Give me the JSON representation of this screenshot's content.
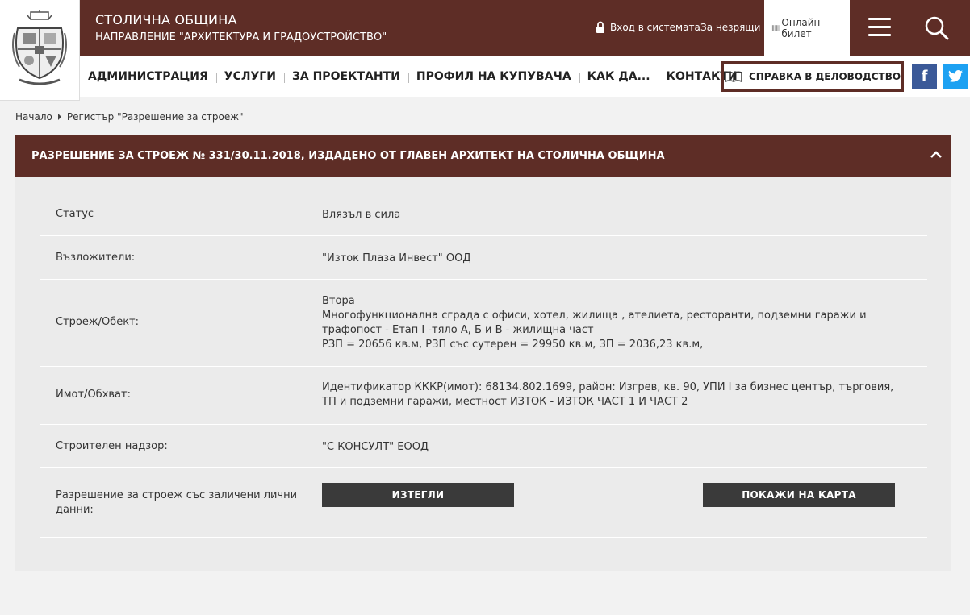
{
  "header": {
    "org_title": "СТОЛИЧНА ОБЩИНА",
    "org_subtitle": "НАПРАВЛЕНИЕ \"АРХИТЕКТУРА И ГРАДОУСТРОЙСТВО\"",
    "login_label": "Вход в системата",
    "visually_impaired_label": "За незрящи",
    "online_ticket_label": "Онлайн билет",
    "menu_icon": "hamburger-icon",
    "search_icon": "search-icon"
  },
  "nav": {
    "items": [
      "АДМИНИСТРАЦИЯ",
      "УСЛУГИ",
      "ЗА ПРОЕКТАНТИ",
      "ПРОФИЛ НА КУПУВАЧА",
      "КАК ДА...",
      "КОНТАКТИ"
    ],
    "docs_button": "СПРАВКА В ДЕЛОВОДСТВО",
    "facebook_label": "f"
  },
  "breadcrumb": {
    "home": "Начало",
    "current": "Регистър \"Разрешение за строеж\""
  },
  "permit": {
    "title": "РАЗРЕШЕНИЕ ЗА СТРОЕЖ № 331/30.11.2018, ИЗДАДЕНО ОТ ГЛАВЕН АРХИТЕКТ НА СТОЛИЧНА ОБЩИНА",
    "status_label": "Статус",
    "status_value": "Влязъл в сила",
    "assignors_label": "Възложители:",
    "assignors_value": "\"Изток Плаза Инвест\" ООД",
    "object_label": "Строеж/Обект:",
    "object_line1": "Втора",
    "object_line2": "Многофункционална сграда с офиси, хотел, жилища , ателиета, ресторанти, подземни гаражи и трафопост - Етап I -тяло А, Б и В - жилищна част",
    "object_line3": "РЗП = 20656 кв.м, РЗП със сутерен = 29950 кв.м, ЗП = 2036,23 кв.м,",
    "property_label": "Имот/Обхват:",
    "property_value": "Идентификатор КККР(имот): 68134.802.1699, район: Изгрев, кв. 90, УПИ I за бизнес център, търговия, ТП и подземни гаражи, местност ИЗТОК - ИЗТОК ЧАСТ 1 И ЧАСТ 2",
    "supervision_label": "Строителен надзор:",
    "supervision_value": "\"С КОНСУЛТ\" ЕООД",
    "download_label": "Разрешение за строеж със заличени лични данни:",
    "download_button": "ИЗТЕГЛИ",
    "map_button": "ПОКАЖИ НА КАРТА"
  },
  "colors": {
    "brand": "#5e2d26",
    "button": "#3a3a3a",
    "facebook": "#3b5998",
    "twitter": "#1da1f2"
  }
}
